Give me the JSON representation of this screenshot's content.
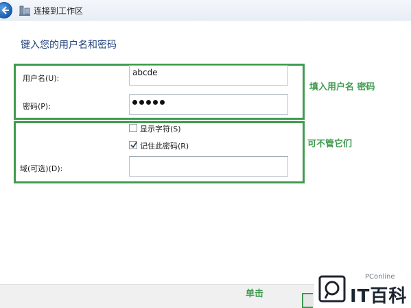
{
  "window": {
    "title": "连接到工作区"
  },
  "form": {
    "heading": "键入您的用户名和密码",
    "username_label": "用户名(U):",
    "username_value": "abcde",
    "password_label": "密码(P):",
    "password_mask_count": 5,
    "show_chars_label": "显示字符(S)",
    "show_chars_checked": false,
    "remember_label": "记住此密码(R)",
    "remember_checked": true,
    "domain_label": "域(可选)(D):",
    "domain_value": ""
  },
  "annotations": {
    "fill_credentials": "填入用户名 密码",
    "ignore_them": "可不管它们",
    "click": "单击"
  },
  "watermark": {
    "site": "PConline",
    "brand": "IT百科"
  },
  "colors": {
    "annotation_green": "#3f9a4f",
    "heading_blue": "#1e3f7a"
  },
  "icons": {
    "back": "back-arrow-icon",
    "network": "network-icon",
    "checkmark": "checkmark-icon"
  }
}
